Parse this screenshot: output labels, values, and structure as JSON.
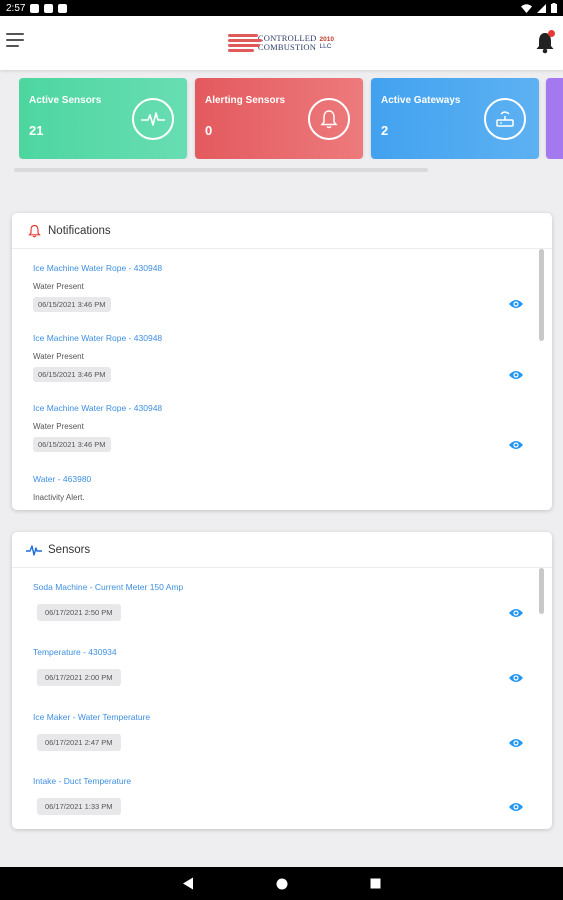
{
  "status_bar": {
    "time": "2:57"
  },
  "app": {
    "logo_line1": "CONTROLLED",
    "logo_line2": "COMBUSTION",
    "logo_year": "2010",
    "logo_suffix": "LLC"
  },
  "cards": [
    {
      "title": "Active Sensors",
      "value": "21",
      "icon": "pulse-icon",
      "color": "#4dd6a0"
    },
    {
      "title": "Alerting Sensors",
      "value": "0",
      "icon": "bell-icon",
      "color": "#e35a5e"
    },
    {
      "title": "Active Gateways",
      "value": "2",
      "icon": "router-icon",
      "color": "#42a2ef"
    }
  ],
  "notifications": {
    "heading": "Notifications",
    "items": [
      {
        "title": "Ice Machine Water Rope - 430948",
        "message": "Water Present",
        "time": "06/15/2021 3:46 PM"
      },
      {
        "title": "Ice Machine Water Rope - 430948",
        "message": "Water Present",
        "time": "06/15/2021 3:46 PM"
      },
      {
        "title": "Ice Machine Water Rope - 430948",
        "message": "Water Present",
        "time": "06/15/2021 3:46 PM"
      },
      {
        "title": "Water - 463980",
        "message": "Inactivity Alert."
      }
    ]
  },
  "sensors": {
    "heading": "Sensors",
    "items": [
      {
        "title": "Soda Machine - Current Meter 150 Amp",
        "time": "06/17/2021 2:50 PM"
      },
      {
        "title": "Temperature - 430934",
        "time": "06/17/2021 2:00 PM"
      },
      {
        "title": "Ice Maker - Water Temperature",
        "time": "06/17/2021 2:47 PM"
      },
      {
        "title": "Intake - Duct Temperature",
        "time": "06/17/2021 1:33 PM"
      }
    ]
  },
  "colors": {
    "link": "#3f8fe0",
    "eye": "#2196f3",
    "bell_alert": "#e53935"
  }
}
